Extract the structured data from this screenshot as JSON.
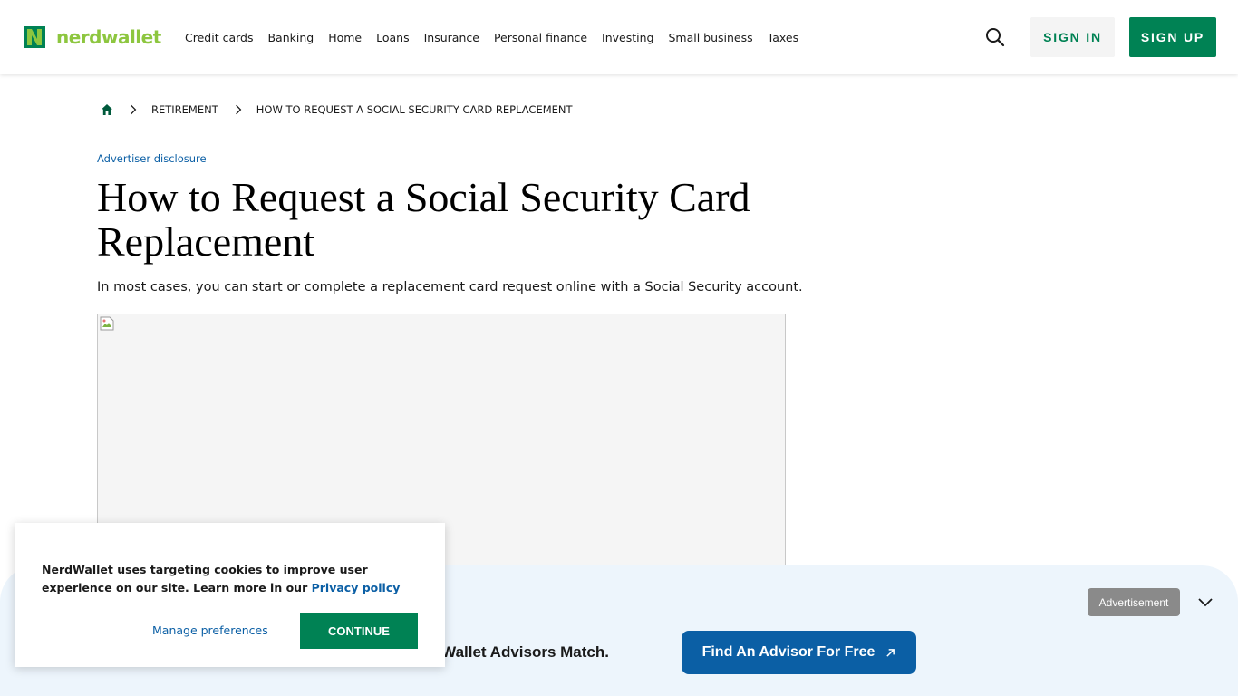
{
  "header": {
    "logo_text": "nerdwallet",
    "brand_color": "#008254",
    "logo_color": "#8dc63f",
    "nav_items": [
      "Credit cards",
      "Banking",
      "Home",
      "Loans",
      "Insurance",
      "Personal finance",
      "Investing",
      "Small business",
      "Taxes"
    ],
    "search_icon": "search-icon",
    "sign_in": "SIGN IN",
    "sign_up": "SIGN UP"
  },
  "breadcrumb": {
    "home_icon": "home-icon",
    "items": [
      "RETIREMENT",
      "HOW TO REQUEST A SOCIAL SECURITY CARD REPLACEMENT"
    ]
  },
  "article": {
    "disclosure": "Advertiser disclosure",
    "title": "How to Request a Social Security Card Replacement",
    "subtitle": "In most cases, you can start or complete a replacement card request online with a Social Security account."
  },
  "ad": {
    "badge": "Advertisement",
    "text": "Wallet Advisors Match.",
    "cta": "Find An Advisor For Free",
    "cta_color": "#0b5fa5",
    "bg_color": "#edf5fc"
  },
  "cookie": {
    "text": "NerdWallet uses targeting cookies to improve user experience on our site. Learn more in our",
    "link": "Privacy policy",
    "manage": "Manage preferences",
    "continue": "CONTINUE"
  }
}
